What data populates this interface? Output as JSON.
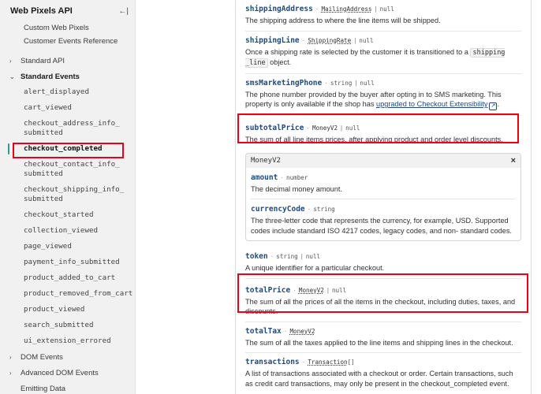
{
  "sidebar": {
    "title": "Web Pixels API",
    "top_links": [
      "Custom Web Pixels",
      "Customer Events Reference"
    ],
    "standard_api": "Standard API",
    "standard_events": "Standard Events",
    "events": [
      "alert_displayed",
      "cart_viewed",
      "checkout_address_info_\nsubmitted",
      "checkout_completed",
      "checkout_contact_info_\nsubmitted",
      "checkout_shipping_info_\nsubmitted",
      "checkout_started",
      "collection_viewed",
      "page_viewed",
      "payment_info_submitted",
      "product_added_to_cart",
      "product_removed_from_cart",
      "product_viewed",
      "search_submitted",
      "ui_extension_errored"
    ],
    "selected_index": 3,
    "dom_events": "DOM Events",
    "advanced_dom_events": "Advanced DOM Events",
    "emitting_data": "Emitting Data"
  },
  "fields": {
    "shippingAddress": {
      "name": "shippingAddress",
      "type": "MailingAddress",
      "null": "null",
      "desc": "The shipping address to where the line items will be shipped."
    },
    "shippingLine": {
      "name": "shippingLine",
      "type": "ShippingRate",
      "null": "null",
      "desc_a": "Once a shipping rate is selected by the customer it is transitioned to a",
      "code": "shipping\n_line",
      "desc_b": "object."
    },
    "smsMarketingPhone": {
      "name": "smsMarketingPhone",
      "type": "string",
      "null": "null",
      "desc": "The phone number provided by the buyer after opting in to SMS marketing. This property is only available if the shop has",
      "link": "upgraded to Checkout Extensibility",
      "end": "."
    },
    "subtotalPrice": {
      "name": "subtotalPrice",
      "type": "MoneyV2",
      "null": "null",
      "desc": "The sum of all line items prices, after applying product and order level discounts."
    },
    "token": {
      "name": "token",
      "type": "string",
      "null": "null",
      "desc": "A unique identifier for a particular checkout."
    },
    "totalPrice": {
      "name": "totalPrice",
      "type": "MoneyV2",
      "null": "null",
      "desc": "The sum of all the prices of all the items in the checkout, including duties, taxes, and discounts."
    },
    "totalTax": {
      "name": "totalTax",
      "type": "MoneyV2",
      "desc": "The sum of all the taxes applied to the line items and shipping lines in the checkout."
    },
    "transactions": {
      "name": "transactions",
      "type": "Transaction",
      "suffix": "[]",
      "desc": "A list of transactions associated with a checkout or order. Certain transactions, such as credit card transactions, may only be present in the checkout_completed event."
    }
  },
  "moneyv2": {
    "title": "MoneyV2",
    "amount": {
      "name": "amount",
      "type": "number",
      "desc": "The decimal money amount."
    },
    "currencyCode": {
      "name": "currencyCode",
      "type": "string",
      "desc": "The three-letter code that represents the currency, for example, USD. Supported codes include standard ISO 4217 codes, legacy codes, and non- standard codes."
    }
  },
  "separator": "|",
  "dot": "·",
  "icons": {
    "collapse": "sidebar-collapse-icon",
    "chevron_right": "chevron-right-icon",
    "chevron_down": "chevron-down-icon",
    "close": "close-icon",
    "external": "external-link-icon"
  },
  "colors": {
    "highlight": "#e8001c",
    "active_bar": "#2a9d8f",
    "field_name": "#1f4a7c"
  }
}
